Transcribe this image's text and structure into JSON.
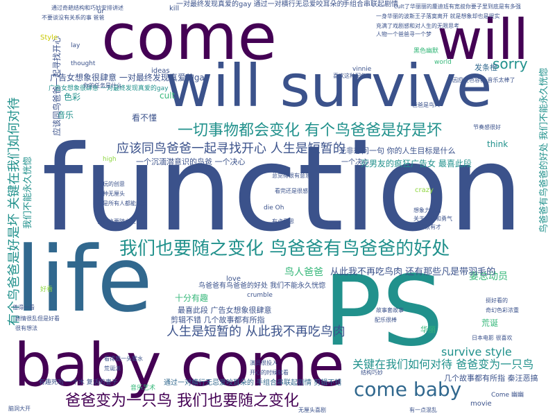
{
  "palette": {
    "dark_purple": "#440154",
    "indigo": "#3b528b",
    "blue": "#31688e",
    "teal": "#21918c",
    "green": "#35b779",
    "light_green": "#90d743",
    "olive_yellow": "#c8c800",
    "background": "#ffffff"
  },
  "words": {
    "function": "function",
    "come": "come",
    "will": "will",
    "will_survive": "will survive",
    "life": "life",
    "ps": "PS",
    "baby_come_big": "baby come",
    "come_baby": "come baby",
    "sorry": "sorry",
    "everything_changes": "一切事物都会变化 有个鸟爸爸是好是坏",
    "we_must_change": "我们也要随之变化 鸟爸爸有鸟爸爸的好处",
    "find_happiness": "应该同鸟爸爸一起寻找开心 人生是短暂的",
    "dad_bird": "爸爸变为一只鸟 我们也要随之变化",
    "key_treat": "关键在我们如何对待 爸爸变为一只鸟",
    "life_short_no_bird": "人生是短暂的 从此我不再吃鸟肉",
    "dream_gay": "一个沉湎潜意识的鸟爸 一个决心",
    "vertical_left_1": "有个鸟爸爸是好是坏 关键在我们如何对待",
    "vertical_left_2": "我们不能永久恍惚",
    "vertical_center": "应该同鸟爸爸一起寻找开心",
    "vertical_right_1": "鸟爸爸有鸟爸爸的好处 我们不能永久恍惚",
    "music": "音乐",
    "color": "色彩",
    "cult": "cult",
    "kill": "kill",
    "ideas": "ideas",
    "think": "think",
    "crazy": "crazy",
    "movie": "movie",
    "love": "love",
    "style": "Style",
    "survive_style": "survive style",
    "birdman": "鸟人爸爸",
    "wife_adventure": "妻总动员",
    "fun": "十分有趣",
    "dont_understand": "看不懂",
    "absurd": "荒诞",
    "huagui": "华丽",
    "yi_ge_jue_xin": "一个决心",
    "dead_friend_ad": "死男友的疯狂广告女 最喜此段",
    "no_more_bird": "从此我不再吃鸟肉 还有那些凡是带羽毛的",
    "ad_dream": "广告女想象很肆意 一对最终发现真爱的gay",
    "gay_top": "一对最终发现真爱的gay 通过一对横行无忌爱咬耳朵的",
    "hand_combo": "手组合串联起剧情",
    "bottom_line": "通过一对横行无忌爱咬耳朵的 手组合串联起剧情 剪辑不错",
    "several_stories": "几个故事都有所指 秦汪恶搞",
    "cut_good": "剪辑不错 几个故事都有所指",
    "wuxian": "无非想问一句 你的人生目标是什么",
    "fafu": "发条橙",
    "yijuzhi": "有趣死啦 一个水 复活的妻子",
    "last_bit": "最喜此段 广告女想象很肆意",
    "dad_has_benefit": "鸟爸爸有鸟爸爸的好处 我们不能永久恍惚",
    "ur": "ur",
    "lay": "lay",
    "thought": "thought",
    "vinnie": "vinnie",
    "die_oh": "die Oh",
    "crumble": "crumble",
    "world": "world",
    "high": "high",
    "good_look": "好看",
    "music2": "音乐艺术",
    "come_yeah": "Come 幽幽"
  },
  "small_text": [
    "通过奇葩结构和巧妙安排讲述",
    "一身华丽的波斯王子落寞离开 就是想象却也是很实",
    "不要谈没有关系的事 爸爸",
    "cult了华丽丽的鏖迪班有宽叔你要子里到底是有多强",
    "充满了戏剧感和对人生的无限思考",
    "人物一个爸爸寻一个梦",
    "黑色幽默",
    "爸爸是鸟人",
    "喜欢这种配色",
    "因应变色容器 音乐太棒了",
    "广告女想象很肆意 一对最终发现真爱的gay",
    "我们也要随之变化",
    "你的任务是什么",
    "好玩的创意",
    "各种无厘头",
    "不是所有人都能欣赏",
    "总觉得很有意思",
    "看完还是很感动",
    "有点意思",
    "想象力丰富",
    "关于梦想和勇气",
    "导演很有才",
    "节奏感很好",
    "挺好看的",
    "奇幻色彩浓重",
    "日本电影 很喜欢",
    "故事套故事",
    "配乐很棒",
    "值得一看",
    "剧情很乱但是好看",
    "很有想法",
    "看得我一头雾水",
    "荒诞派",
    "演员很投入",
    "开心的时候就看",
    "结构巧妙",
    "有一点混乱",
    "无厘头喜剧",
    "脑洞大开"
  ]
}
